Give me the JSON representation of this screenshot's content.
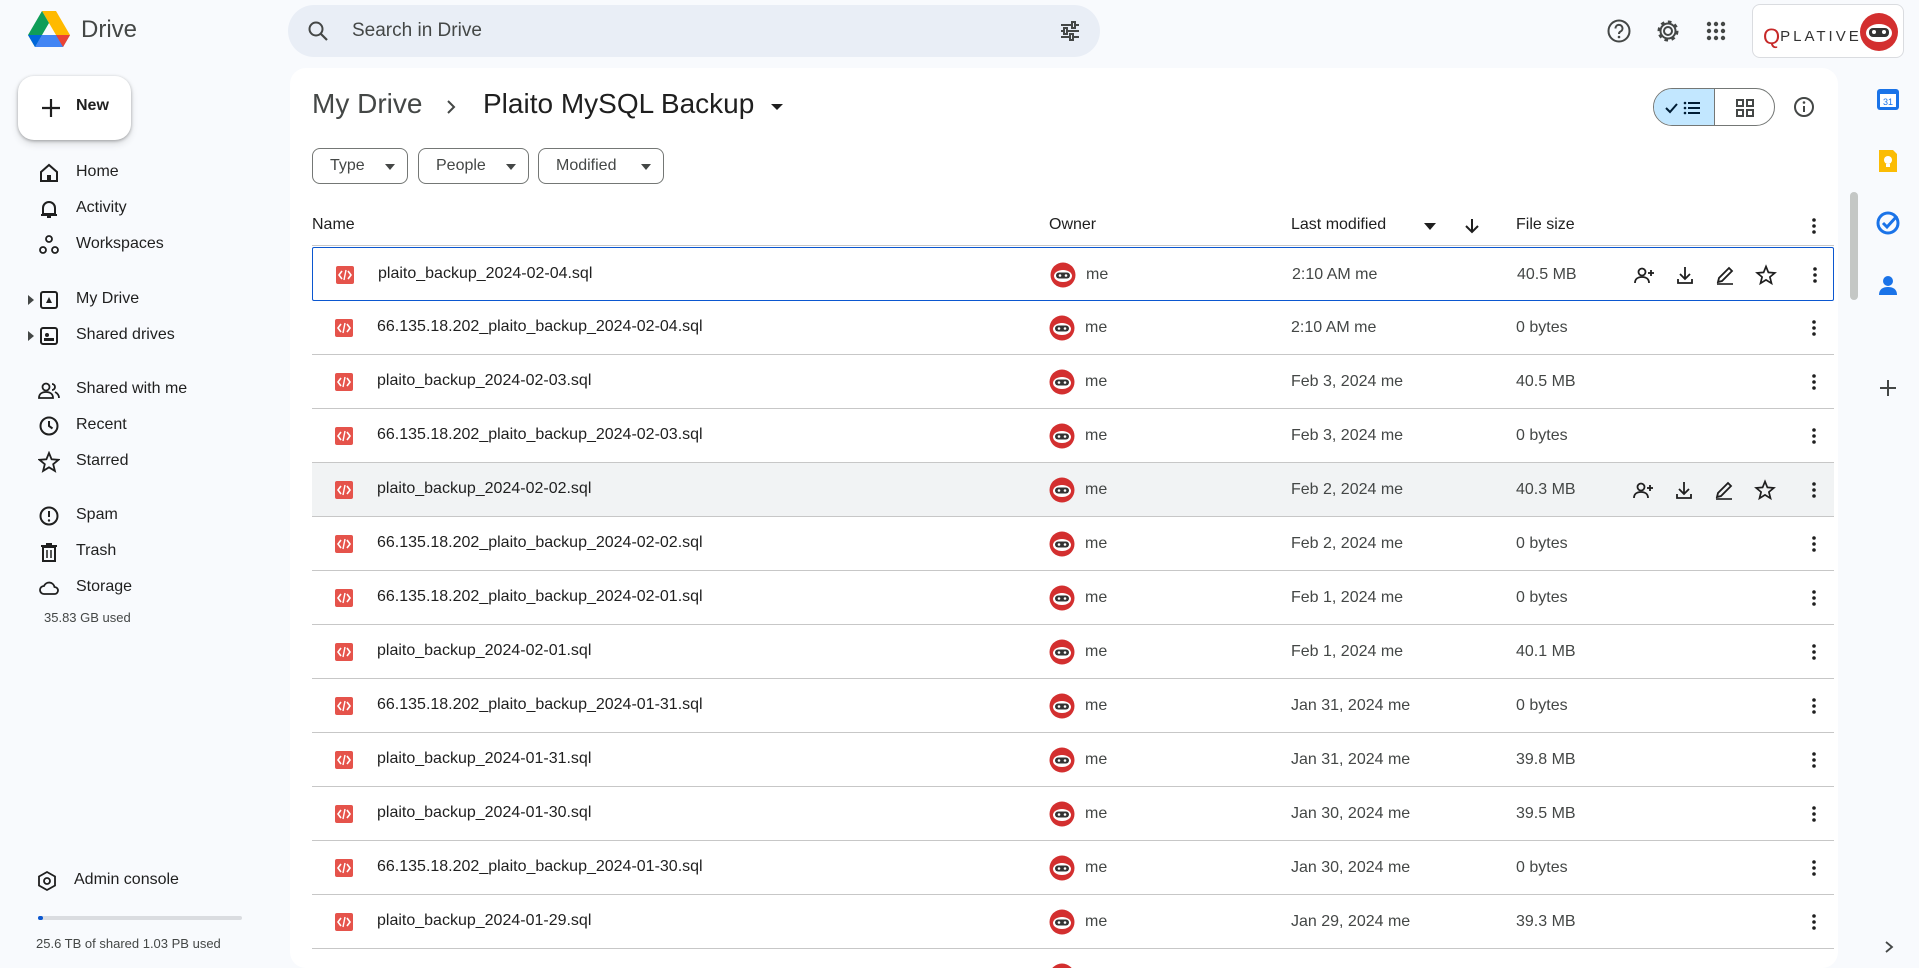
{
  "app": {
    "name": "Drive"
  },
  "search": {
    "placeholder": "Search in Drive"
  },
  "account": {
    "org_logo": "PLATIVE"
  },
  "sidebar": {
    "new_label": "New",
    "items": [
      {
        "label": "Home",
        "icon": "home-icon"
      },
      {
        "label": "Activity",
        "icon": "bell-icon"
      },
      {
        "label": "Workspaces",
        "icon": "workspaces-icon"
      },
      {
        "label": "My Drive",
        "icon": "my-drive-icon"
      },
      {
        "label": "Shared drives",
        "icon": "shared-drives-icon"
      },
      {
        "label": "Shared with me",
        "icon": "people-icon"
      },
      {
        "label": "Recent",
        "icon": "clock-icon"
      },
      {
        "label": "Starred",
        "icon": "star-icon"
      },
      {
        "label": "Spam",
        "icon": "spam-icon"
      },
      {
        "label": "Trash",
        "icon": "trash-icon"
      },
      {
        "label": "Storage",
        "icon": "cloud-icon"
      }
    ],
    "storage_used": "35.83 GB used",
    "admin_console": "Admin console",
    "shared_storage": "25.6 TB of shared 1.03 PB used",
    "shared_storage_fraction": 0.025
  },
  "breadcrumb": {
    "root": "My Drive",
    "current": "Plaito MySQL Backup"
  },
  "filters": [
    "Type",
    "People",
    "Modified"
  ],
  "table": {
    "headers": {
      "name": "Name",
      "owner": "Owner",
      "modified": "Last modified",
      "size": "File size"
    },
    "rows": [
      {
        "name": "plaito_backup_2024-02-04.sql",
        "owner": "me",
        "modified": "2:10 AM  me",
        "size": "40.5 MB"
      },
      {
        "name": "66.135.18.202_plaito_backup_2024-02-04.sql",
        "owner": "me",
        "modified": "2:10 AM  me",
        "size": "0 bytes"
      },
      {
        "name": "plaito_backup_2024-02-03.sql",
        "owner": "me",
        "modified": "Feb 3, 2024  me",
        "size": "40.5 MB"
      },
      {
        "name": "66.135.18.202_plaito_backup_2024-02-03.sql",
        "owner": "me",
        "modified": "Feb 3, 2024  me",
        "size": "0 bytes"
      },
      {
        "name": "plaito_backup_2024-02-02.sql",
        "owner": "me",
        "modified": "Feb 2, 2024  me",
        "size": "40.3 MB"
      },
      {
        "name": "66.135.18.202_plaito_backup_2024-02-02.sql",
        "owner": "me",
        "modified": "Feb 2, 2024  me",
        "size": "0 bytes"
      },
      {
        "name": "66.135.18.202_plaito_backup_2024-02-01.sql",
        "owner": "me",
        "modified": "Feb 1, 2024  me",
        "size": "0 bytes"
      },
      {
        "name": "plaito_backup_2024-02-01.sql",
        "owner": "me",
        "modified": "Feb 1, 2024  me",
        "size": "40.1 MB"
      },
      {
        "name": "66.135.18.202_plaito_backup_2024-01-31.sql",
        "owner": "me",
        "modified": "Jan 31, 2024  me",
        "size": "0 bytes"
      },
      {
        "name": "plaito_backup_2024-01-31.sql",
        "owner": "me",
        "modified": "Jan 31, 2024  me",
        "size": "39.8 MB"
      },
      {
        "name": "plaito_backup_2024-01-30.sql",
        "owner": "me",
        "modified": "Jan 30, 2024  me",
        "size": "39.5 MB"
      },
      {
        "name": "66.135.18.202_plaito_backup_2024-01-30.sql",
        "owner": "me",
        "modified": "Jan 30, 2024  me",
        "size": "0 bytes"
      },
      {
        "name": "plaito_backup_2024-01-29.sql",
        "owner": "me",
        "modified": "Jan 29, 2024  me",
        "size": "39.3 MB"
      }
    ]
  },
  "colors": {
    "accent": "#0b57d0",
    "selected_view": "#c2e7ff",
    "file_icon": "#e5534b",
    "page_bg": "#f8fafd"
  }
}
